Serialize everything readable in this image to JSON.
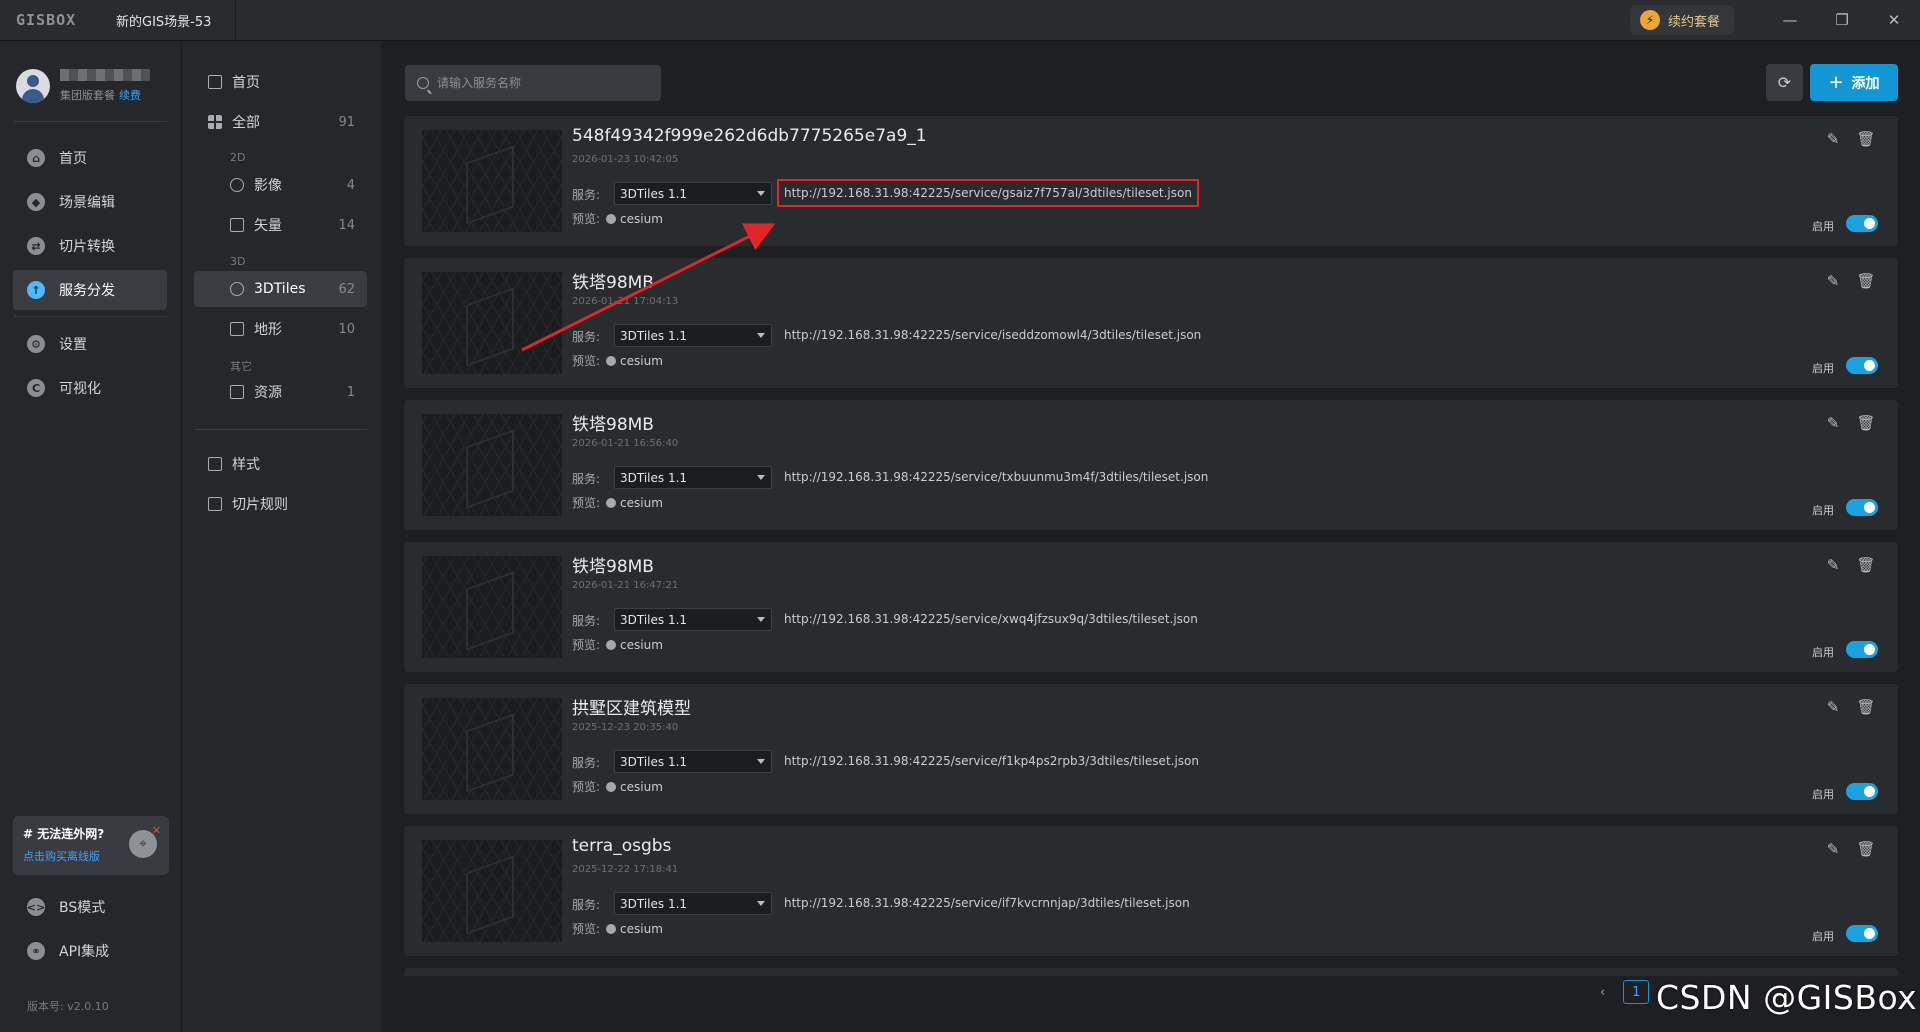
{
  "titlebar": {
    "logo": "GISBOX",
    "tab_title": "新的GIS场景-53",
    "renew_label": "续约套餐",
    "minimize": "—",
    "restore": "❐",
    "close": "✕"
  },
  "user": {
    "plan": "集团版套餐",
    "renew_link": "续费"
  },
  "leftnav": {
    "items": [
      {
        "label": "首页",
        "icon": "home-icon"
      },
      {
        "label": "场景编辑",
        "icon": "cube-icon"
      },
      {
        "label": "切片转换",
        "icon": "convert-icon"
      },
      {
        "label": "服务分发",
        "icon": "upload-cloud-icon"
      },
      {
        "label": "设置",
        "icon": "gear-icon"
      },
      {
        "label": "可视化",
        "icon": "visual-icon"
      },
      {
        "label": "BS模式",
        "icon": "code-icon"
      },
      {
        "label": "API集成",
        "icon": "api-icon"
      }
    ],
    "offline_question": "# 无法连外网?",
    "offline_action": "点击购买离线版",
    "version": "版本号: v2.0.10"
  },
  "categories": {
    "home": "首页",
    "all": {
      "label": "全部",
      "count": "91"
    },
    "group_2d": "2D",
    "imagery": {
      "label": "影像",
      "count": "4"
    },
    "vector": {
      "label": "矢量",
      "count": "14"
    },
    "group_3d": "3D",
    "tiles3d": {
      "label": "3DTiles",
      "count": "62"
    },
    "terrain": {
      "label": "地形",
      "count": "10"
    },
    "group_other": "其它",
    "resource": {
      "label": "资源",
      "count": "1"
    },
    "style": "样式",
    "tile_rules": "切片规则"
  },
  "toolbar": {
    "search_placeholder": "请输入服务名称",
    "add_label": "添加"
  },
  "card_labels": {
    "service": "服务:",
    "preview": "预览:",
    "enable": "启用"
  },
  "services": [
    {
      "name": "548f49342f999e262d6db7775265e7a9_1",
      "date": "2026-01-23 10:42:05",
      "type": "3DTiles 1.1",
      "url": "http://192.168.31.98:42225/service/gsaiz7f757al/3dtiles/tileset.json",
      "preview": "cesium",
      "enabled": true
    },
    {
      "name": "铁塔98MB",
      "date": "2026-01-21 17:04:13",
      "type": "3DTiles 1.1",
      "url": "http://192.168.31.98:42225/service/iseddzomowl4/3dtiles/tileset.json",
      "preview": "cesium",
      "enabled": true
    },
    {
      "name": "铁塔98MB",
      "date": "2026-01-21 16:56:40",
      "type": "3DTiles 1.1",
      "url": "http://192.168.31.98:42225/service/txbuunmu3m4f/3dtiles/tileset.json",
      "preview": "cesium",
      "enabled": true
    },
    {
      "name": "铁塔98MB",
      "date": "2026-01-21 16:47:21",
      "type": "3DTiles 1.1",
      "url": "http://192.168.31.98:42225/service/xwq4jfzsux9q/3dtiles/tileset.json",
      "preview": "cesium",
      "enabled": true
    },
    {
      "name": "拱墅区建筑模型",
      "date": "2025-12-23 20:35:40",
      "type": "3DTiles 1.1",
      "url": "http://192.168.31.98:42225/service/f1kp4ps2rpb3/3dtiles/tileset.json",
      "preview": "cesium",
      "enabled": true
    },
    {
      "name": "terra_osgbs",
      "date": "2025-12-22 17:18:41",
      "type": "3DTiles 1.1",
      "url": "http://192.168.31.98:42225/service/if7kvcrnnjap/3dtiles/tileset.json",
      "preview": "cesium",
      "enabled": true
    }
  ],
  "pager": {
    "prev": "‹",
    "current": "1"
  },
  "watermark": "CSDN @GISBox",
  "colors": {
    "accent": "#1596d4",
    "highlight": "#e0262b",
    "toggle_on": "#1aa3e0"
  }
}
